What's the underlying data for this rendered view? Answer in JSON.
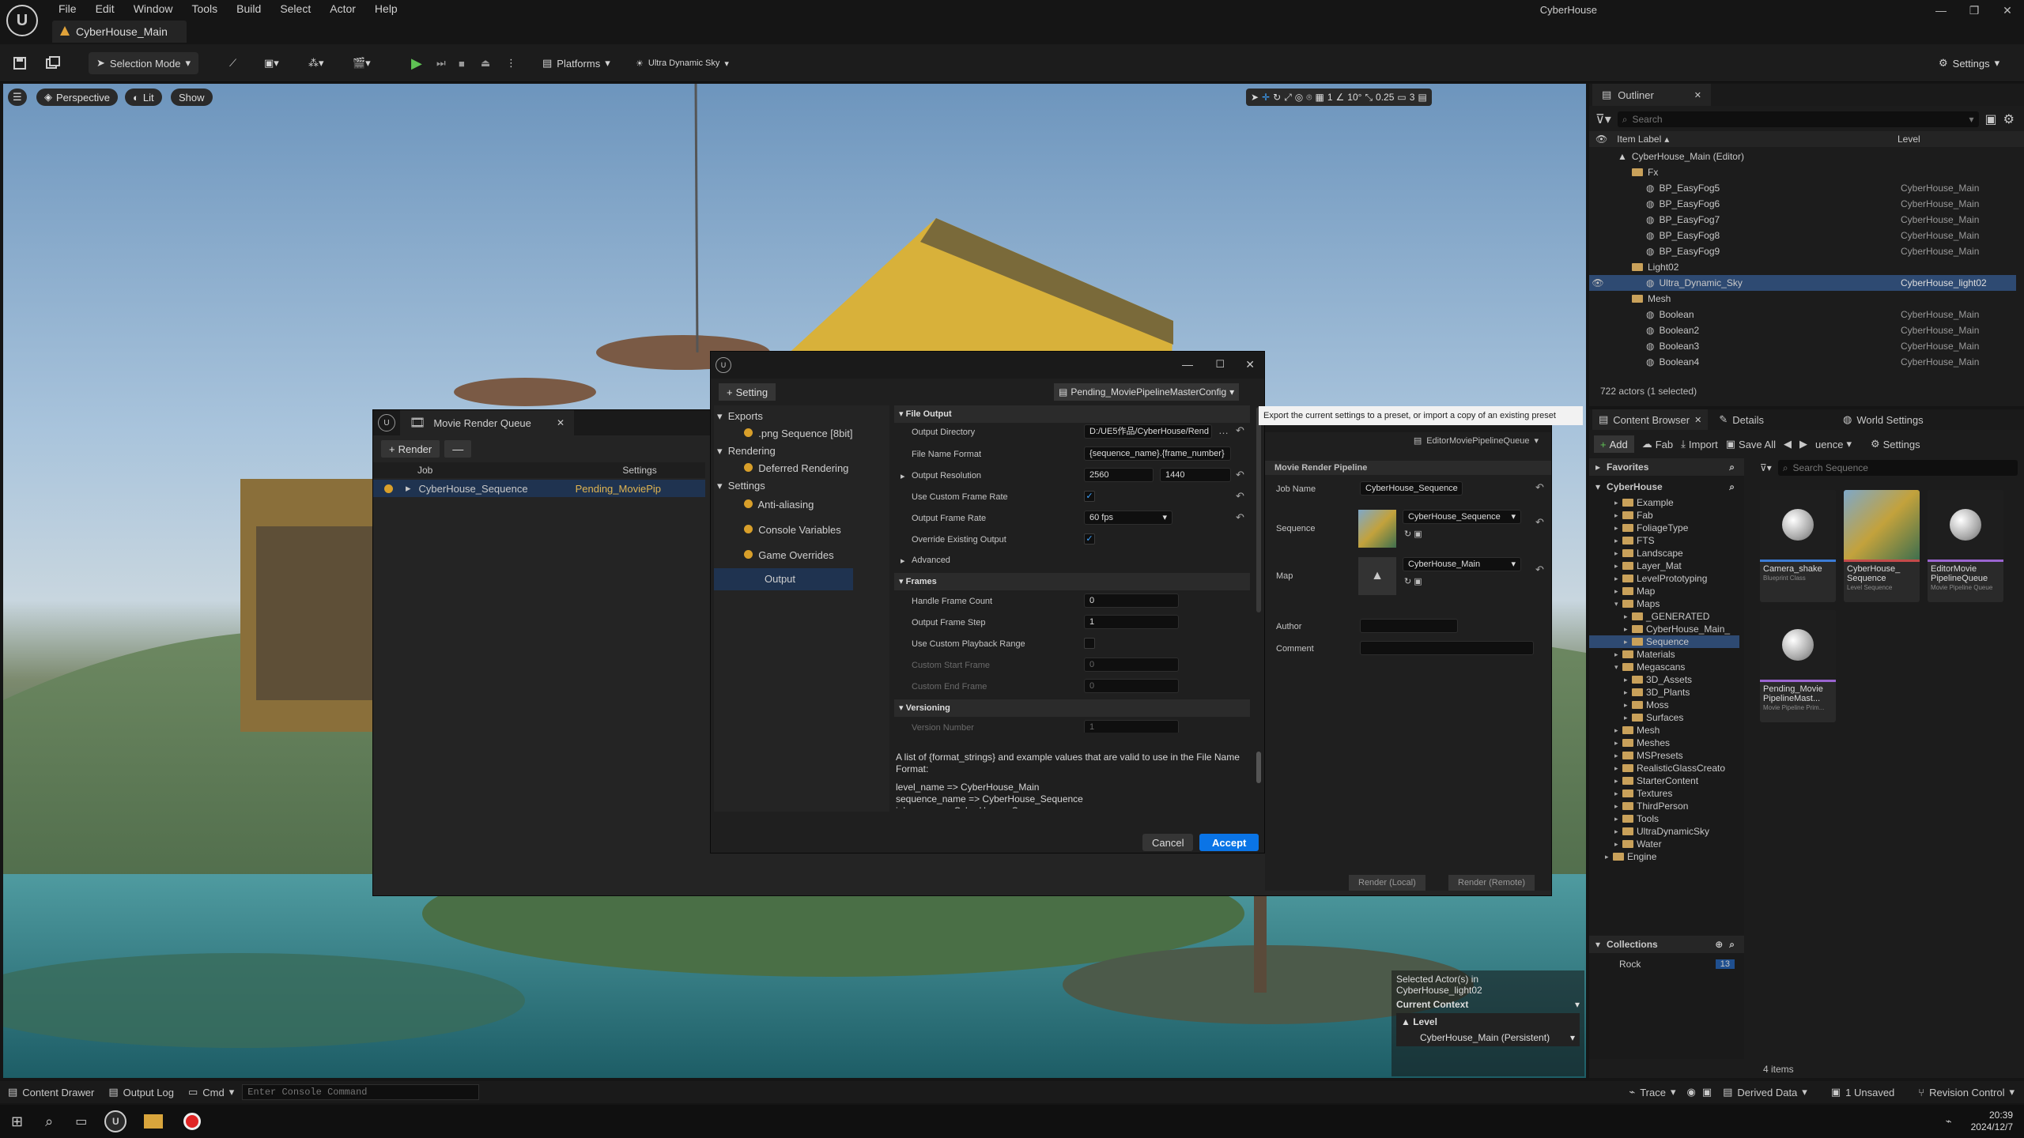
{
  "app": {
    "name": "CyberHouse",
    "map_tab": "CyberHouse_Main"
  },
  "menu": [
    "File",
    "Edit",
    "Window",
    "Tools",
    "Build",
    "Select",
    "Actor",
    "Help"
  ],
  "toolbar": {
    "selection_mode": "Selection Mode",
    "platforms": "Platforms",
    "sky": "Ultra Dynamic Sky",
    "settings": "Settings"
  },
  "viewport": {
    "perspective": "Perspective",
    "lit": "Lit",
    "show": "Show",
    "grid": "1",
    "angle": "10°",
    "scale": "0.25",
    "camera": "3"
  },
  "mrq": {
    "title": "Movie Render Queue",
    "render": "Render",
    "col_job": "Job",
    "col_settings": "Settings",
    "job": "CyberHouse_Sequence",
    "job_settings": "Pending_MoviePip",
    "render_local": "Render (Local)",
    "render_remote": "Render (Remote)",
    "pipeline_dropdown": "EditorMoviePipelineQueue",
    "section": "Movie Render Pipeline",
    "job_name_label": "Job Name",
    "job_name": "CyberHouse_Sequence",
    "sequence_label": "Sequence",
    "sequence": "CyberHouse_Sequence",
    "map_label": "Map",
    "map": "CyberHouse_Main",
    "author_label": "Author",
    "comment_label": "Comment"
  },
  "settings_dialog": {
    "setting_btn": "Setting",
    "preset": "Pending_MoviePipelineMasterConfig",
    "tooltip": "Export the current settings to a preset, or import a copy of an existing preset",
    "nav": {
      "exports": "Exports",
      "png": ".png Sequence [8bit]",
      "rendering": "Rendering",
      "deferred": "Deferred Rendering",
      "settings": "Settings",
      "aa": "Anti-aliasing",
      "cvars": "Console Variables",
      "game": "Game Overrides",
      "output": "Output"
    },
    "file_output": "File Output",
    "output_dir_label": "Output Directory",
    "output_dir": "D:/UE5作品/CyberHouse/Rend",
    "filename_label": "File Name Format",
    "filename": "{sequence_name}.{frame_number}",
    "resolution_label": "Output Resolution",
    "res_w": "2560",
    "res_h": "1440",
    "custom_fr_label": "Use Custom Frame Rate",
    "framerate_label": "Output Frame Rate",
    "framerate": "60 fps",
    "override_label": "Override Existing Output",
    "advanced": "Advanced",
    "frames": "Frames",
    "handle_label": "Handle Frame Count",
    "handle": "0",
    "step_label": "Output Frame Step",
    "step": "1",
    "playback_label": "Use Custom Playback Range",
    "start_label": "Custom Start Frame",
    "start": "0",
    "end_label": "Custom End Frame",
    "end": "0",
    "versioning": "Versioning",
    "version_label": "Version Number",
    "version": "1",
    "help_text": "A list of {format_strings} and example values that are valid to use in the File Name Format:",
    "help_lines": [
      "level_name => CyberHouse_Main",
      "sequence_name => CyberHouse_Sequence",
      "job_name => CyberHouse_Sequence"
    ],
    "cancel": "Cancel",
    "accept": "Accept"
  },
  "outliner": {
    "tab": "Outliner",
    "search": "Search",
    "col_label": "Item Label",
    "col_level": "Level",
    "status": "722 actors (1 selected)",
    "items": [
      {
        "name": "CyberHouse_Main (Editor)",
        "level": "",
        "type": "root",
        "indent": 0
      },
      {
        "name": "Fx",
        "level": "",
        "type": "folder",
        "indent": 1
      },
      {
        "name": "BP_EasyFog5",
        "level": "CyberHouse_Main",
        "type": "actor",
        "indent": 2
      },
      {
        "name": "BP_EasyFog6",
        "level": "CyberHouse_Main",
        "type": "actor",
        "indent": 2
      },
      {
        "name": "BP_EasyFog7",
        "level": "CyberHouse_Main",
        "type": "actor",
        "indent": 2
      },
      {
        "name": "BP_EasyFog8",
        "level": "CyberHouse_Main",
        "type": "actor",
        "indent": 2
      },
      {
        "name": "BP_EasyFog9",
        "level": "CyberHouse_Main",
        "type": "actor",
        "indent": 2
      },
      {
        "name": "Light02",
        "level": "",
        "type": "folder",
        "indent": 1
      },
      {
        "name": "Ultra_Dynamic_Sky",
        "level": "CyberHouse_light02",
        "type": "selected",
        "indent": 2
      },
      {
        "name": "Mesh",
        "level": "",
        "type": "folder",
        "indent": 1
      },
      {
        "name": "Boolean",
        "level": "CyberHouse_Main",
        "type": "actor",
        "indent": 2
      },
      {
        "name": "Boolean2",
        "level": "CyberHouse_Main",
        "type": "actor",
        "indent": 2
      },
      {
        "name": "Boolean3",
        "level": "CyberHouse_Main",
        "type": "actor",
        "indent": 2
      },
      {
        "name": "Boolean4",
        "level": "CyberHouse_Main",
        "type": "actor",
        "indent": 2
      }
    ]
  },
  "content_browser": {
    "tab": "Content Browser",
    "details": "Details",
    "world": "World Settings",
    "add": "Add",
    "fab": "Fab",
    "import": "Import",
    "save_all": "Save All",
    "path": "uence",
    "settings": "Settings",
    "search": "Search Sequence",
    "favorites": "Favorites",
    "root": "CyberHouse",
    "folders": [
      {
        "name": "Example",
        "indent": 1
      },
      {
        "name": "Fab",
        "indent": 1
      },
      {
        "name": "FoliageType",
        "indent": 1
      },
      {
        "name": "FTS",
        "indent": 1
      },
      {
        "name": "Landscape",
        "indent": 1
      },
      {
        "name": "Layer_Mat",
        "indent": 1
      },
      {
        "name": "LevelPrototyping",
        "indent": 1
      },
      {
        "name": "Map",
        "indent": 1
      },
      {
        "name": "Maps",
        "indent": 1
      },
      {
        "name": "_GENERATED",
        "indent": 2
      },
      {
        "name": "CyberHouse_Main_",
        "indent": 2
      },
      {
        "name": "Sequence",
        "indent": 2
      },
      {
        "name": "Materials",
        "indent": 1
      },
      {
        "name": "Megascans",
        "indent": 1
      },
      {
        "name": "3D_Assets",
        "indent": 2
      },
      {
        "name": "3D_Plants",
        "indent": 2
      },
      {
        "name": "Moss",
        "indent": 2
      },
      {
        "name": "Surfaces",
        "indent": 2
      },
      {
        "name": "Mesh",
        "indent": 1
      },
      {
        "name": "Meshes",
        "indent": 1
      },
      {
        "name": "MSPresets",
        "indent": 1
      },
      {
        "name": "RealisticGlassCreato",
        "indent": 1
      },
      {
        "name": "StarterContent",
        "indent": 1
      },
      {
        "name": "Textures",
        "indent": 1
      },
      {
        "name": "ThirdPerson",
        "indent": 1
      },
      {
        "name": "Tools",
        "indent": 1
      },
      {
        "name": "UltraDynamicSky",
        "indent": 1
      },
      {
        "name": "Water",
        "indent": 1
      },
      {
        "name": "Engine",
        "indent": 0
      }
    ],
    "collections": "Collections",
    "collection_item": "Rock",
    "collection_count": "13",
    "count": "4 items",
    "assets": [
      {
        "name": "Camera_shake",
        "type": "Blueprint Class"
      },
      {
        "name": "CyberHouse_\nSequence",
        "type": "Level Sequence"
      },
      {
        "name": "EditorMovie\nPipelineQueue",
        "type": "Movie Pipeline Queue"
      },
      {
        "name": "Pending_Movie\nPipelineMast...",
        "type": "Movie Pipeline Prim..."
      }
    ]
  },
  "context": {
    "selected": "Selected Actor(s) in",
    "level_name": "CyberHouse_light02",
    "current": "Current Context",
    "level": "Level",
    "persistent": "CyberHouse_Main (Persistent)"
  },
  "statusbar": {
    "drawer": "Content Drawer",
    "log": "Output Log",
    "cmd": "Cmd",
    "console_placeholder": "Enter Console Command",
    "trace": "Trace",
    "derived": "Derived Data",
    "unsaved": "1 Unsaved",
    "revision": "Revision Control"
  },
  "taskbar": {
    "time": "20:39",
    "date": "2024/12/7"
  }
}
